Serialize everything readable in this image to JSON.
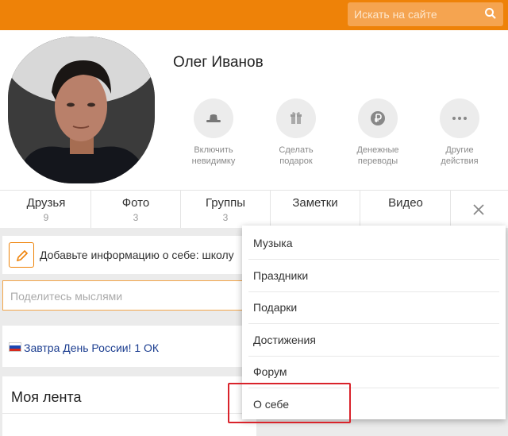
{
  "search": {
    "placeholder": "Искать на сайте"
  },
  "profile": {
    "name": "Олег Иванов"
  },
  "actions": [
    {
      "line1": "Включить",
      "line2": "невидимку",
      "icon": "hat-icon"
    },
    {
      "line1": "Сделать",
      "line2": "подарок",
      "icon": "gift-icon"
    },
    {
      "line1": "Денежные",
      "line2": "переводы",
      "icon": "ruble-icon"
    },
    {
      "line1": "Другие",
      "line2": "действия",
      "icon": "more-dots-icon"
    }
  ],
  "tabs": [
    {
      "label": "Друзья",
      "count": "9"
    },
    {
      "label": "Фото",
      "count": "3"
    },
    {
      "label": "Группы",
      "count": "3"
    },
    {
      "label": "Заметки",
      "count": ""
    },
    {
      "label": "Видео",
      "count": ""
    }
  ],
  "info": {
    "text": "Добавьте информацию о себе: школу"
  },
  "post": {
    "placeholder": "Поделитесь мыслями"
  },
  "news": {
    "text": "Завтра День России! 1 ОК"
  },
  "feed": {
    "title": "Моя лента"
  },
  "dropdown": {
    "items": [
      "Музыка",
      "Праздники",
      "Подарки",
      "Достижения",
      "Форум",
      "О себе"
    ]
  },
  "colors": {
    "brand": "#ee8208",
    "highlight": "#d9232b",
    "link": "#1c3e90"
  }
}
